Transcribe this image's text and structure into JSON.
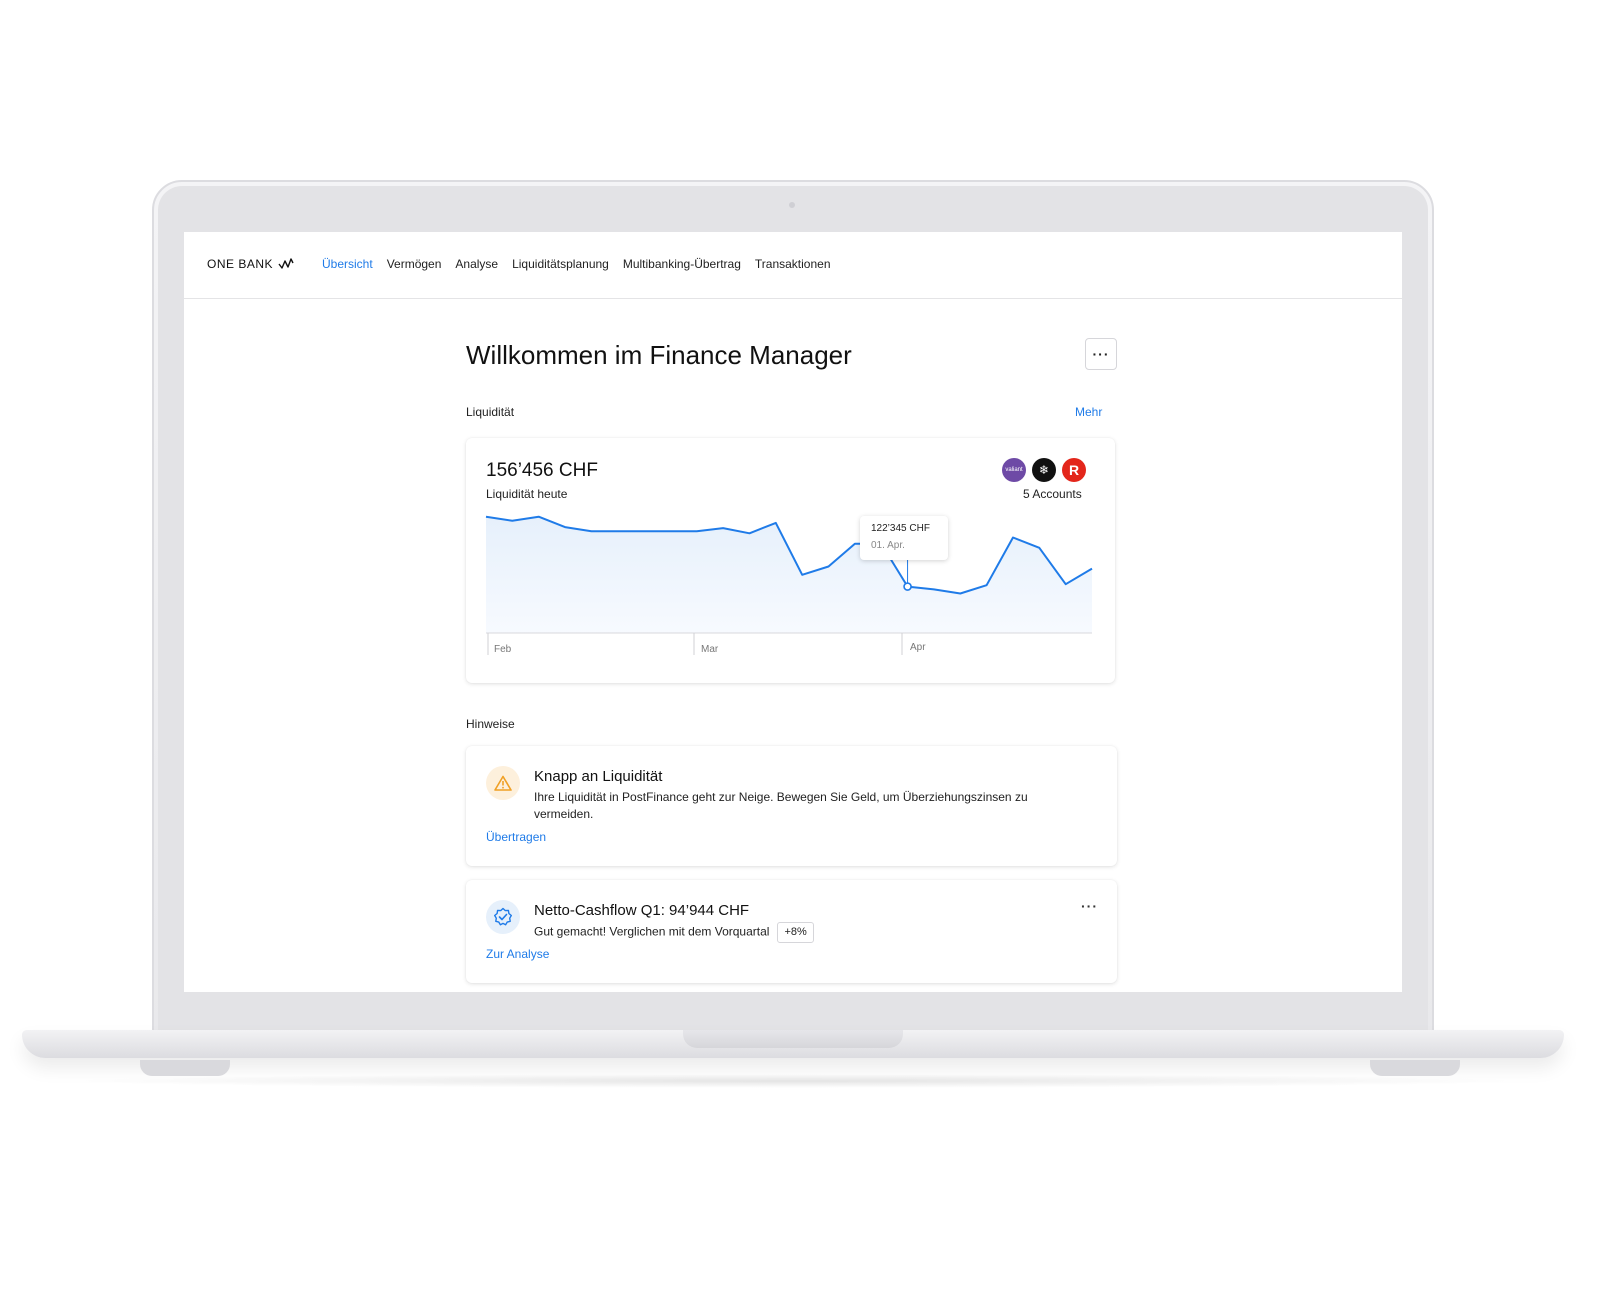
{
  "nav": {
    "brand": "ONE BANK",
    "links": [
      "Übersicht",
      "Vermögen",
      "Analyse",
      "Liquiditätsplanung",
      "Multibanking-Übertrag",
      "Transaktionen"
    ],
    "active_index": 0
  },
  "page": {
    "title": "Willkommen im Finance Manager",
    "more_label": "···"
  },
  "liquidity": {
    "section_label": "Liquidität",
    "more_link": "Mehr",
    "amount": "156’456 CHF",
    "amount_caption": "Liquidität heute",
    "accounts_label": "5 Accounts",
    "logos": [
      {
        "name": "valiant",
        "text": "valiant",
        "color": "#6e4aa6"
      },
      {
        "name": "bank-2",
        "text": "❄",
        "color": "#111111"
      },
      {
        "name": "raiffeisen",
        "text": "R",
        "color": "#e3261b"
      }
    ],
    "tooltip": {
      "value": "122’345 CHF",
      "date": "01. Apr."
    }
  },
  "chart_data": {
    "type": "area",
    "x_tick_labels": [
      "Feb",
      "Mar",
      "Apr"
    ],
    "series": [
      {
        "values": [
          156000,
          154000,
          156000,
          151000,
          149000,
          149000,
          149000,
          149000,
          149000,
          150500,
          148000,
          153000,
          128000,
          132000,
          143000,
          143000,
          122345,
          121000,
          119000,
          123000,
          146000,
          141000,
          123500,
          131000
        ]
      }
    ],
    "ylim": [
      100000,
      165000
    ],
    "colors": {
      "line": "#1f7be8",
      "fill": "#e8f1fb"
    }
  },
  "hints": {
    "section_label": "Hinweise",
    "items": [
      {
        "icon": "warning-icon",
        "title": "Knapp an Liquidität",
        "text": "Ihre Liquidität in PostFinance geht zur Neige. Bewegen Sie Geld, um Überziehungszinsen zu vermeiden.",
        "action": "Übertragen"
      },
      {
        "icon": "verified-badge-icon",
        "title": "Netto-Cashflow Q1: 94’944 CHF",
        "text": "Gut gemacht! Verglichen mit dem Vorquartal",
        "badge": "+8%",
        "action": "Zur Analyse",
        "more_label": "···"
      }
    ]
  },
  "colors": {
    "accent": "#1f7be8",
    "warning": "#f0a025",
    "warning_bg": "#fdf0dc",
    "info_bg": "#e6f0fb"
  }
}
